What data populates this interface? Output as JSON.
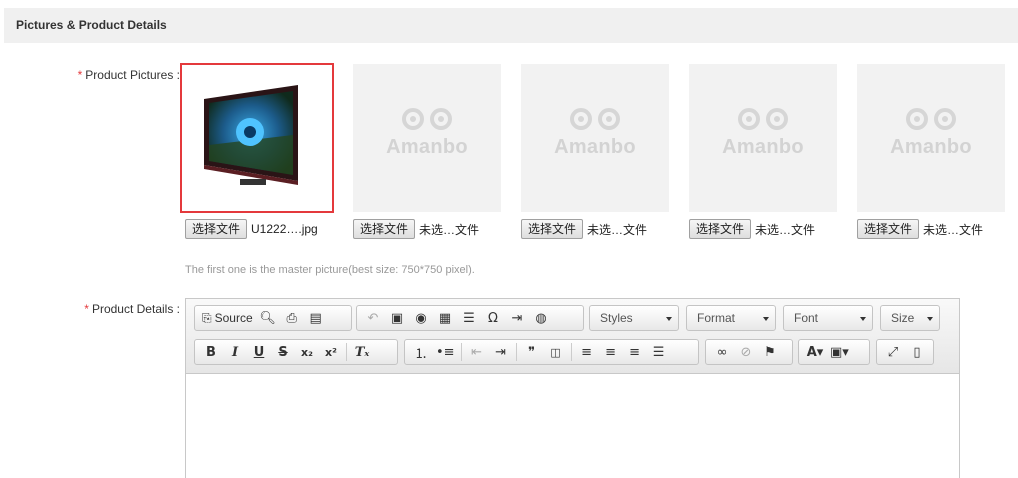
{
  "section": {
    "title": "Pictures & Product Details"
  },
  "pictures": {
    "required_mark": "*",
    "label": "Product Pictures :",
    "placeholder_brand": "Amanbo",
    "choose_button": "选择文件",
    "slots": [
      {
        "file_name": "U1222….jpg",
        "has_image": true
      },
      {
        "file_name": "未选…文件",
        "has_image": false
      },
      {
        "file_name": "未选…文件",
        "has_image": false
      },
      {
        "file_name": "未选…文件",
        "has_image": false
      },
      {
        "file_name": "未选…文件",
        "has_image": false
      }
    ],
    "hint": "The first one is the master picture(best size: 750*750 pixel)."
  },
  "details": {
    "required_mark": "*",
    "label": "Product Details :",
    "toolbar": {
      "source_label": "Source",
      "styles_label": "Styles",
      "format_label": "Format",
      "font_label": "Font",
      "size_label": "Size"
    }
  },
  "colors": {
    "required": "#e4393c",
    "master_border": "#e4393c",
    "header_bg": "#f0f0f0"
  }
}
